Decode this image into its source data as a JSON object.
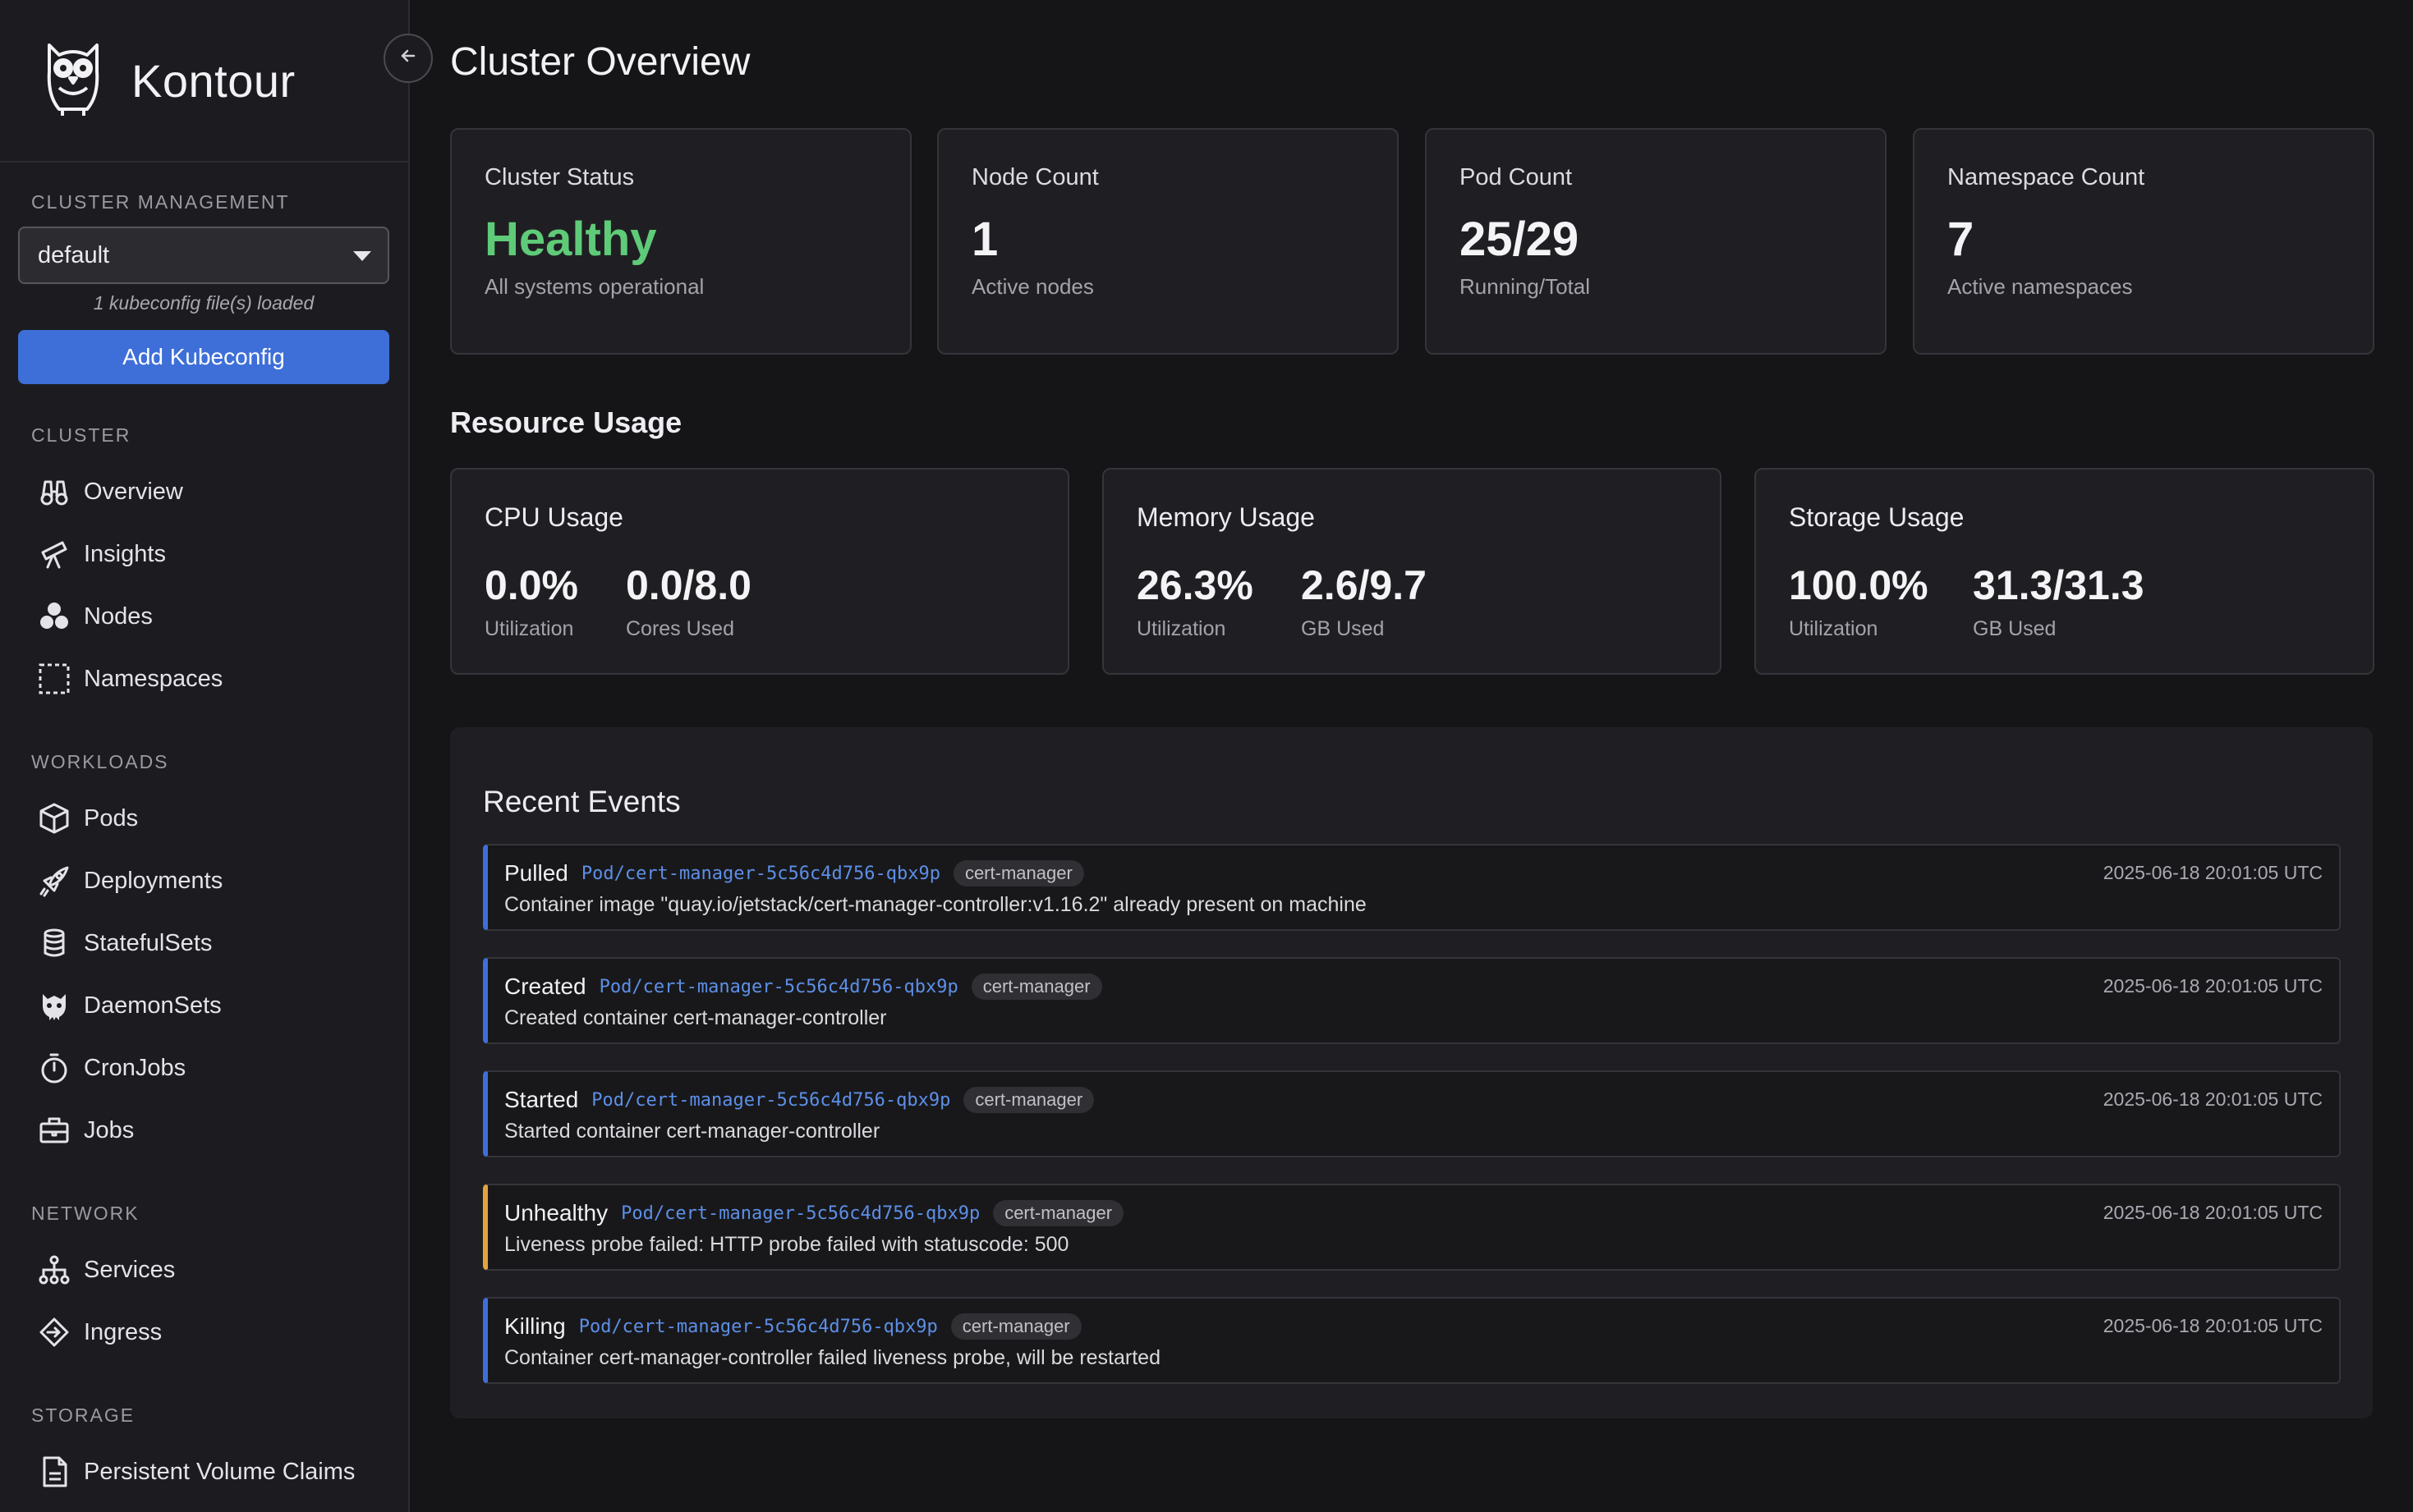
{
  "app": {
    "name": "Kontour"
  },
  "sidebar": {
    "cluster_management_label": "CLUSTER MANAGEMENT",
    "context_select": {
      "value": "default"
    },
    "kubeconfig_note": "1 kubeconfig file(s) loaded",
    "add_button": "Add Kubeconfig",
    "sections": {
      "cluster": "CLUSTER",
      "workloads": "WORKLOADS",
      "network": "NETWORK",
      "storage": "STORAGE"
    },
    "items": {
      "overview": {
        "label": "Overview",
        "icon": "binoculars-icon"
      },
      "insights": {
        "label": "Insights",
        "icon": "telescope-icon"
      },
      "nodes": {
        "label": "Nodes",
        "icon": "nodes-icon"
      },
      "namespaces": {
        "label": "Namespaces",
        "icon": "dashed-square-icon"
      },
      "pods": {
        "label": "Pods",
        "icon": "cube-icon"
      },
      "deployments": {
        "label": "Deployments",
        "icon": "rocket-icon"
      },
      "statefulsets": {
        "label": "StatefulSets",
        "icon": "database-icon"
      },
      "daemonsets": {
        "label": "DaemonSets",
        "icon": "daemon-icon"
      },
      "cronjobs": {
        "label": "CronJobs",
        "icon": "stopwatch-icon"
      },
      "jobs": {
        "label": "Jobs",
        "icon": "briefcase-icon"
      },
      "services": {
        "label": "Services",
        "icon": "network-icon"
      },
      "ingress": {
        "label": "Ingress",
        "icon": "ingress-icon"
      },
      "pvc": {
        "label": "Persistent Volume Claims",
        "icon": "file-icon"
      }
    }
  },
  "main": {
    "title": "Cluster Overview",
    "stats": {
      "status": {
        "label": "Cluster Status",
        "value": "Healthy",
        "sub": "All systems operational"
      },
      "nodes": {
        "label": "Node Count",
        "value": "1",
        "sub": "Active nodes"
      },
      "pods": {
        "label": "Pod Count",
        "value": "25/29",
        "sub": "Running/Total"
      },
      "namespaces": {
        "label": "Namespace Count",
        "value": "7",
        "sub": "Active namespaces"
      }
    },
    "resource_title": "Resource Usage",
    "resources": {
      "cpu": {
        "title": "CPU Usage",
        "util": "0.0%",
        "util_label": "Utilization",
        "used": "0.0/8.0",
        "used_label": "Cores Used"
      },
      "memory": {
        "title": "Memory Usage",
        "util": "26.3%",
        "util_label": "Utilization",
        "used": "2.6/9.7",
        "used_label": "GB Used"
      },
      "storage": {
        "title": "Storage Usage",
        "util": "100.0%",
        "util_label": "Utilization",
        "used": "31.3/31.3",
        "used_label": "GB Used"
      }
    },
    "events_title": "Recent Events",
    "events": [
      {
        "reason": "Pulled",
        "object": "Pod/cert-manager-5c56c4d756-qbx9p",
        "namespace": "cert-manager",
        "message": "Container image \"quay.io/jetstack/cert-manager-controller:v1.16.2\" already present on machine",
        "time": "2025-06-18 20:01:05 UTC"
      },
      {
        "reason": "Created",
        "object": "Pod/cert-manager-5c56c4d756-qbx9p",
        "namespace": "cert-manager",
        "message": "Created container cert-manager-controller",
        "time": "2025-06-18 20:01:05 UTC"
      },
      {
        "reason": "Started",
        "object": "Pod/cert-manager-5c56c4d756-qbx9p",
        "namespace": "cert-manager",
        "message": "Started container cert-manager-controller",
        "time": "2025-06-18 20:01:05 UTC"
      },
      {
        "reason": "Unhealthy",
        "object": "Pod/cert-manager-5c56c4d756-qbx9p",
        "namespace": "cert-manager",
        "message": "Liveness probe failed: HTTP probe failed with statuscode: 500",
        "time": "2025-06-18 20:01:05 UTC"
      },
      {
        "reason": "Killing",
        "object": "Pod/cert-manager-5c56c4d756-qbx9p",
        "namespace": "cert-manager",
        "message": "Container cert-manager-controller failed liveness probe, will be restarted",
        "time": "2025-06-18 20:01:05 UTC"
      }
    ]
  },
  "colors": {
    "accent": "#3e6fd8",
    "healthy": "#5fcb78",
    "warning": "#e3a23d",
    "object_link": "#5d8fe6"
  }
}
